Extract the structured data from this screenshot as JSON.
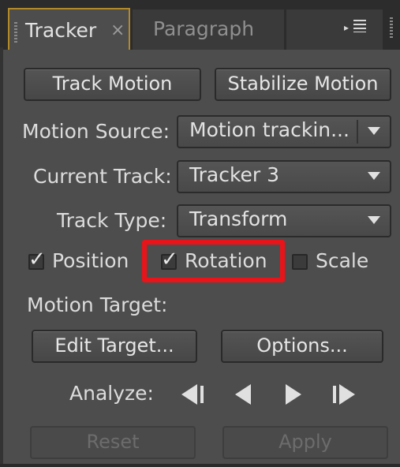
{
  "tabs": {
    "active_label": "Tracker",
    "close_glyph": "×",
    "inactive_label": "Paragraph"
  },
  "buttons": {
    "track_motion": "Track Motion",
    "stabilize_motion": "Stabilize Motion",
    "edit_target": "Edit Target...",
    "options": "Options...",
    "reset": "Reset",
    "apply": "Apply"
  },
  "fields": {
    "motion_source_label": "Motion Source:",
    "motion_source_value": "Motion trackin...",
    "current_track_label": "Current Track:",
    "current_track_value": "Tracker 3",
    "track_type_label": "Track Type:",
    "track_type_value": "Transform"
  },
  "checkboxes": [
    {
      "label": "Position",
      "checked": true
    },
    {
      "label": "Rotation",
      "checked": true
    },
    {
      "label": "Scale",
      "checked": false
    }
  ],
  "motion_target_label": "Motion Target:",
  "analyze_label": "Analyze:",
  "icons": {
    "panel_menu": "panel-menu-icon",
    "analyze_back_frame": "step-back-icon",
    "analyze_backward": "play-backward-icon",
    "analyze_forward": "play-forward-icon",
    "analyze_forward_frame": "step-forward-icon"
  },
  "colors": {
    "panel_bg": "#4d4d4d",
    "active_tab_outline": "#b28a2a",
    "highlight": "#e8141a"
  }
}
